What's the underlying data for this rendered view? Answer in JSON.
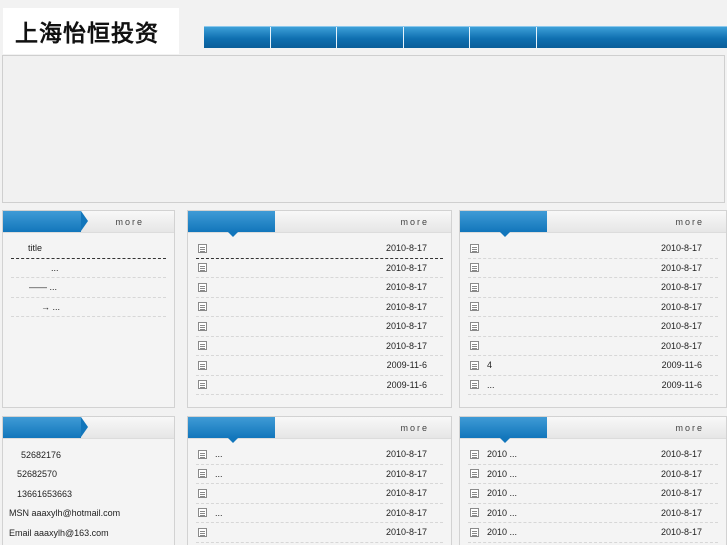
{
  "logo": {
    "text": "上海怡恒投资"
  },
  "nav": {
    "items": [
      "",
      "",
      "",
      "",
      "",
      ""
    ]
  },
  "more_label": "more",
  "left_panel": {
    "rows": [
      {
        "text": "title",
        "indent": 17
      },
      {
        "text": "...",
        "indent": 40
      },
      {
        "text": "—— ...",
        "indent": 18
      },
      {
        "text": "→ ...",
        "indent": 30
      }
    ]
  },
  "news_panel_1": {
    "rows": [
      {
        "title": "",
        "date": "2010-8-17"
      },
      {
        "title": "",
        "date": "2010-8-17"
      },
      {
        "title": "",
        "date": "2010-8-17"
      },
      {
        "title": "",
        "date": "2010-8-17"
      },
      {
        "title": "",
        "date": "2010-8-17"
      },
      {
        "title": "",
        "date": "2010-8-17"
      },
      {
        "title": "",
        "date": "2009-11-6"
      },
      {
        "title": "",
        "date": "2009-11-6"
      }
    ]
  },
  "news_panel_2": {
    "rows": [
      {
        "title": "",
        "date": "2010-8-17"
      },
      {
        "title": "",
        "date": "2010-8-17"
      },
      {
        "title": "",
        "date": "2010-8-17"
      },
      {
        "title": "",
        "date": "2010-8-17"
      },
      {
        "title": "",
        "date": "2010-8-17"
      },
      {
        "title": "",
        "date": "2010-8-17"
      },
      {
        "title": "4",
        "date": "2009-11-6"
      },
      {
        "title": "              ...",
        "date": "2009-11-6"
      }
    ]
  },
  "contact_panel": {
    "lines": [
      {
        "text": "52682176",
        "indent": 12
      },
      {
        "text": "52682570",
        "indent": 8
      },
      {
        "text": "13661653663",
        "indent": 8
      },
      {
        "text": "MSN aaaxylh@hotmail.com",
        "indent": 0
      },
      {
        "text": "Email aaaxylh@163.com",
        "indent": 0
      }
    ]
  },
  "news_panel_3": {
    "rows": [
      {
        "title": "              ...",
        "date": "2010-8-17"
      },
      {
        "title": "              ...",
        "date": "2010-8-17"
      },
      {
        "title": "",
        "date": "2010-8-17"
      },
      {
        "title": "              ...",
        "date": "2010-8-17"
      },
      {
        "title": "",
        "date": "2010-8-17"
      }
    ]
  },
  "news_panel_4": {
    "rows": [
      {
        "title": "2010          ...",
        "date": "2010-8-17"
      },
      {
        "title": "2010          ...",
        "date": "2010-8-17"
      },
      {
        "title": "2010          ...",
        "date": "2010-8-17"
      },
      {
        "title": "2010          ...",
        "date": "2010-8-17"
      },
      {
        "title": "2010          ...",
        "date": "2010-8-17"
      }
    ]
  }
}
